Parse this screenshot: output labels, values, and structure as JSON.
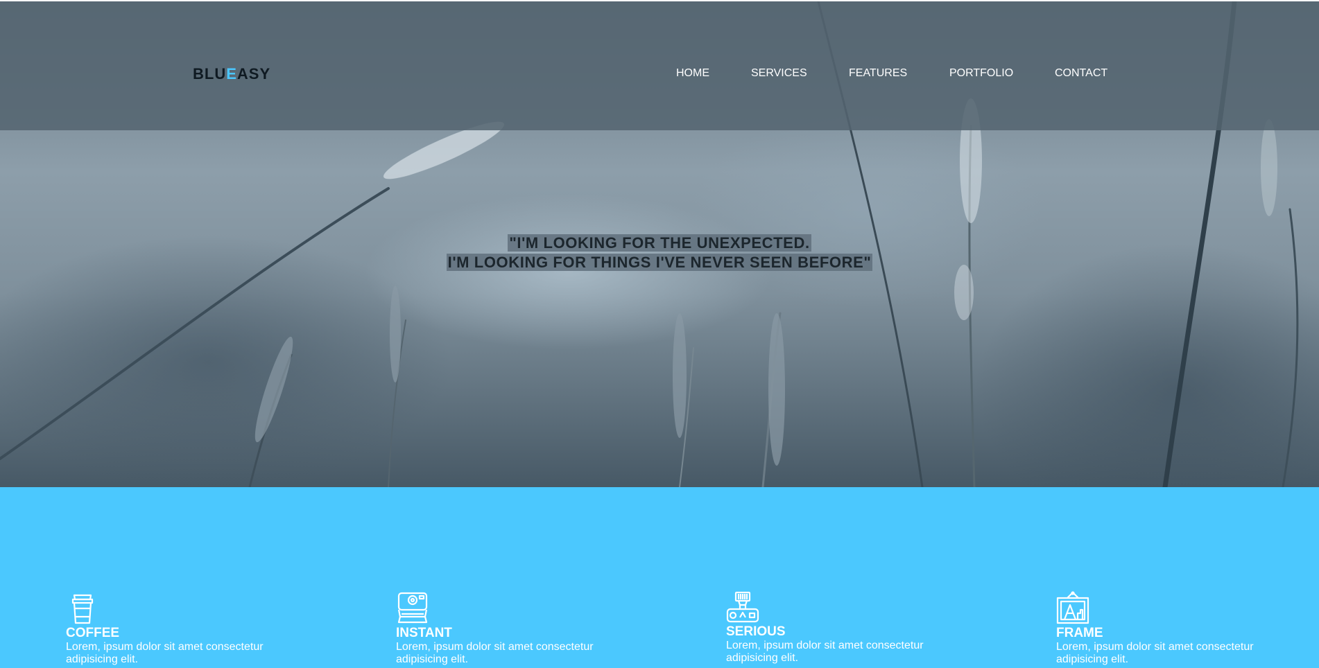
{
  "header": {
    "logo": {
      "part1": "BLU",
      "accent": "E",
      "part2": "ASY"
    },
    "nav": [
      "HOME",
      "SERVICES",
      "FEATURES",
      "PORTFOLIO",
      "CONTACT"
    ]
  },
  "hero": {
    "quote_line1": "\"I'M LOOKING FOR THE UNEXPECTED.",
    "quote_line2": "I'M LOOKING FOR THINGS I'VE NEVER SEEN BEFORE\""
  },
  "features": [
    {
      "icon": "coffee-cup-icon",
      "title": "COFFEE",
      "text": "Lorem, ipsum dolor sit amet consectetur adipisicing elit."
    },
    {
      "icon": "instant-camera-icon",
      "title": "INSTANT",
      "text": "Lorem, ipsum dolor sit amet consectetur adipisicing elit."
    },
    {
      "icon": "camera-flash-icon",
      "title": "SERIOUS",
      "text": "Lorem, ipsum dolor sit amet consectetur adipisicing elit."
    },
    {
      "icon": "picture-frame-icon",
      "title": "FRAME",
      "text": "Lorem, ipsum dolor sit amet consectetur adipisicing elit."
    }
  ],
  "colors": {
    "accent": "#4ac7ff",
    "features_background": "#4bc8fe",
    "header_overlay": "#546470"
  }
}
